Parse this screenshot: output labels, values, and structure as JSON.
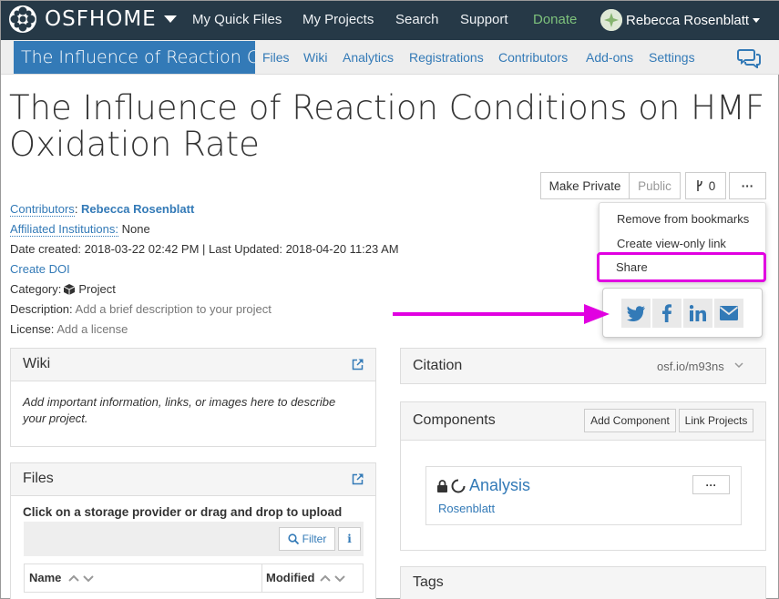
{
  "nav": {
    "brand": "OSFHOME",
    "links": [
      "My Quick Files",
      "My Projects",
      "Search",
      "Support",
      "Donate"
    ],
    "user": "Rebecca Rosenblatt"
  },
  "project_nav": {
    "title": "The Influence of Reaction Co...",
    "tabs": [
      "Files",
      "Wiki",
      "Analytics",
      "Registrations",
      "Contributors",
      "Add-ons",
      "Settings"
    ]
  },
  "page": {
    "title": "The Influence of Reaction Conditions on HMF Oxidation Rate"
  },
  "actions": {
    "make_private": "Make Private",
    "public": "Public",
    "fork_count": "0",
    "more": "···"
  },
  "meta": {
    "contributors_label": "Contributors",
    "contributor": "Rebecca Rosenblatt",
    "affiliated_label": "Affiliated Institutions:",
    "affiliated_value": "None",
    "dates": "Date created: 2018-03-22 02:42 PM | Last Updated: 2018-04-20 11:23 AM",
    "create_doi": "Create DOI",
    "category_label": "Category:",
    "category_value": "Project",
    "description_label": "Description:",
    "description_value": "Add a brief description to your project",
    "license_label": "License:",
    "license_value": "Add a license"
  },
  "dropdown": {
    "items": [
      "Remove from bookmarks",
      "Create view-only link",
      "Share"
    ]
  },
  "share_icons": [
    "twitter-icon",
    "facebook-icon",
    "linkedin-icon",
    "email-icon"
  ],
  "wiki": {
    "title": "Wiki",
    "body": "Add important information, links, or images here to describe your project."
  },
  "files": {
    "title": "Files",
    "hint": "Click on a storage provider or drag and drop to upload",
    "filter": "Filter",
    "info": "i",
    "col_name": "Name",
    "col_modified": "Modified"
  },
  "citation": {
    "title": "Citation",
    "link": "osf.io/m93ns"
  },
  "components": {
    "title": "Components",
    "add": "Add Component",
    "link": "Link Projects",
    "item_name": "Analysis",
    "item_author": "Rosenblatt",
    "item_more": "···"
  },
  "tags": {
    "title": "Tags"
  },
  "colors": {
    "navbar": "#263947",
    "accent": "#337ab7",
    "highlight": "#e100e1",
    "donate": "#7ec27c"
  }
}
